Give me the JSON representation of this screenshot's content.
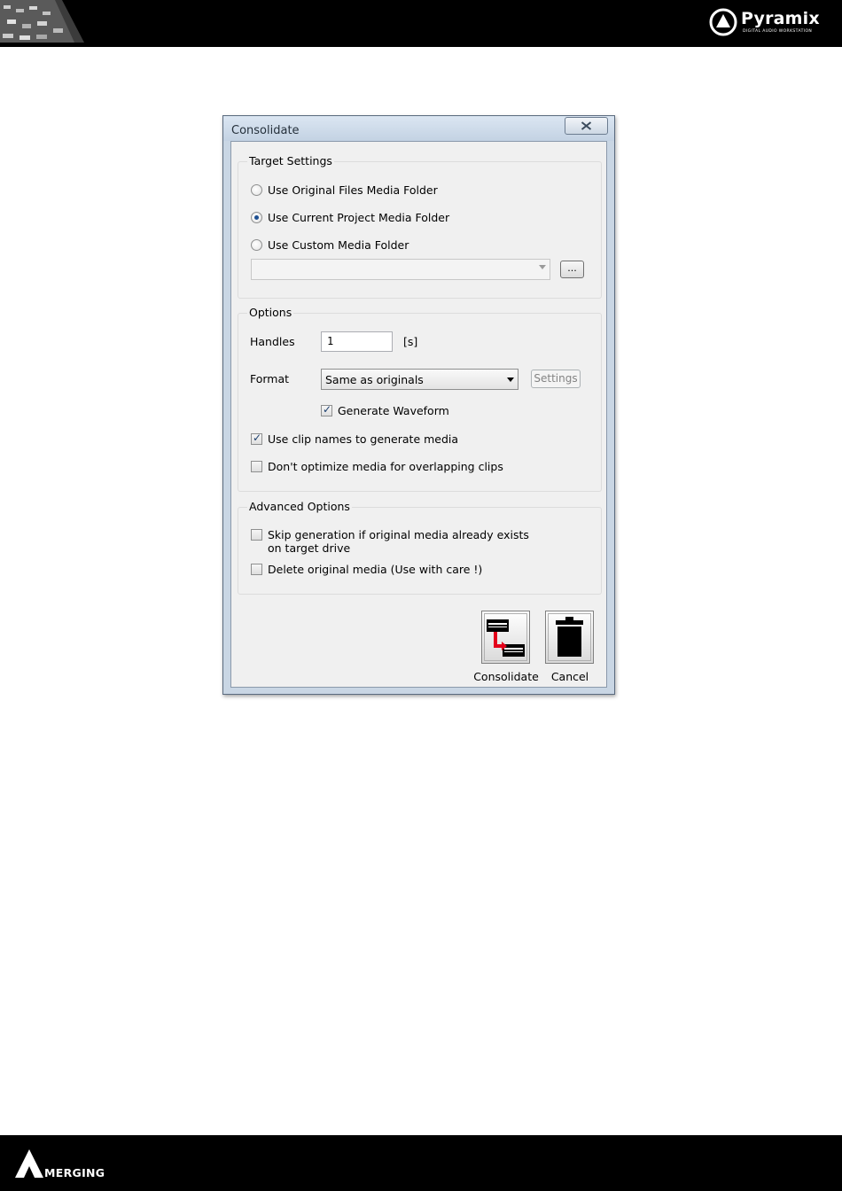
{
  "header": {
    "logo_name": "Pyramix",
    "logo_tagline": "DIGITAL AUDIO WORKSTATION"
  },
  "footer": {
    "logo_name": "MERGING"
  },
  "dialog": {
    "title": "Consolidate",
    "target_settings": {
      "title": "Target Settings",
      "options": [
        {
          "label": "Use Original Files Media Folder",
          "selected": false
        },
        {
          "label": "Use Current Project Media Folder",
          "selected": true
        },
        {
          "label": "Use Custom Media Folder",
          "selected": false
        }
      ],
      "custom_folder_value": "",
      "browse_label": "..."
    },
    "options": {
      "title": "Options",
      "handles_label": "Handles",
      "handles_value": "1",
      "handles_unit": "[s]",
      "format_label": "Format",
      "format_value": "Same as originals",
      "settings_label": "Settings",
      "generate_waveform": {
        "label": "Generate Waveform",
        "checked": true
      },
      "use_clip_names": {
        "label": "Use clip names to generate media",
        "checked": true
      },
      "dont_optimize": {
        "label": "Don't optimize media for overlapping clips",
        "checked": false
      }
    },
    "advanced": {
      "title": "Advanced Options",
      "skip_generation": {
        "label_line1": "Skip generation if original media already exists",
        "label_line2": "on target drive",
        "checked": false
      },
      "delete_original": {
        "label": "Delete original media (Use with care !)",
        "checked": false
      }
    },
    "buttons": {
      "consolidate_label": "Consolidate",
      "cancel_label": "Cancel"
    }
  },
  "colors": {
    "title_bar": "#c9d6e4",
    "dialog_background": "#f0f0f0",
    "radio_dot": "#1d4f91",
    "consolidate_arrow": "#e3001b"
  }
}
